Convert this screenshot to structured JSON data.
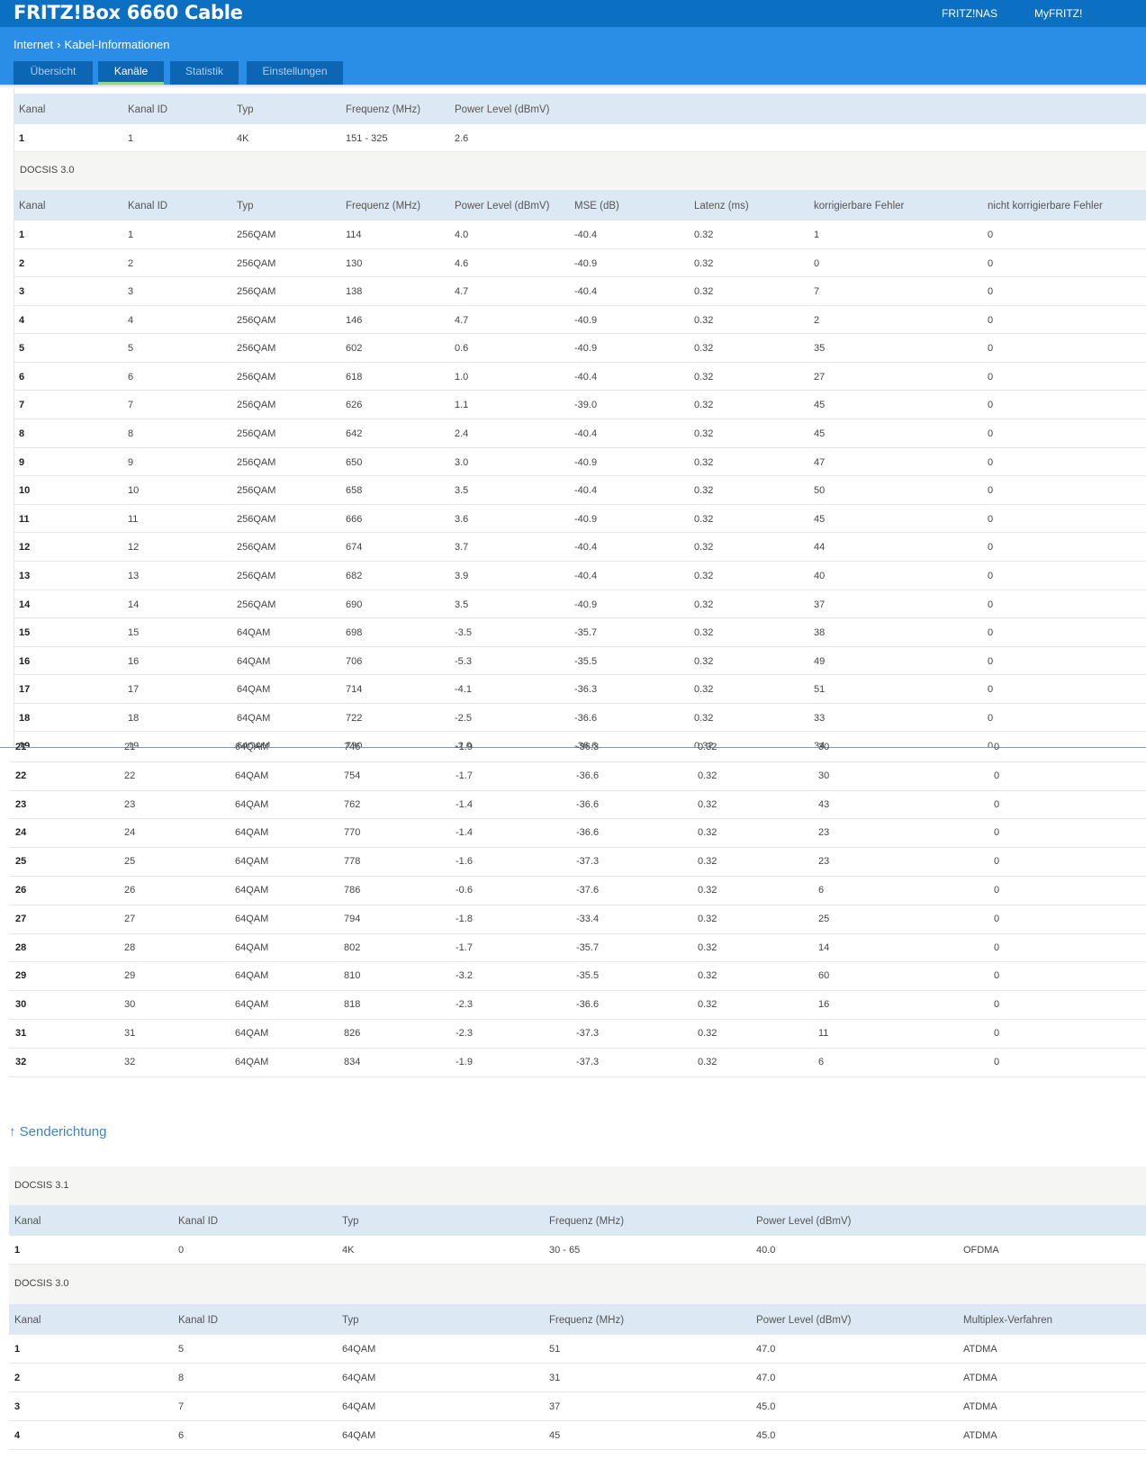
{
  "app": {
    "title": "FRITZ!Box 6660 Cable",
    "top_links": [
      "FRITZ!NAS",
      "MyFRITZ!"
    ],
    "breadcrumb": [
      "Internet",
      "Kabel-Informationen"
    ],
    "breadcrumb_sep": "›",
    "tabs": [
      "Übersicht",
      "Kanäle",
      "Statistik",
      "Einstellungen"
    ],
    "active_tab": "Kanäle"
  },
  "colors": {
    "header": "#0c70c2",
    "subheader": "#2a8ee6",
    "tab_bg": "#0d66b4",
    "tab_active_underline": "#9bd86c",
    "table_head": "#dce9f4"
  },
  "downstream": {
    "docsis31": {
      "headers": [
        "Kanal",
        "Kanal ID",
        "Typ",
        "Frequenz (MHz)",
        "Power Level (dBmV)"
      ],
      "rows": [
        [
          "1",
          "1",
          "4K",
          "151 - 325",
          "2.6"
        ]
      ]
    },
    "docsis30": {
      "label": "DOCSIS 3.0",
      "headers": [
        "Kanal",
        "Kanal ID",
        "Typ",
        "Frequenz (MHz)",
        "Power Level (dBmV)",
        "MSE (dB)",
        "Latenz (ms)",
        "korrigierbare Fehler",
        "nicht korrigierbare Fehler"
      ],
      "rows_top": [
        [
          "1",
          "1",
          "256QAM",
          "114",
          "4.0",
          "-40.4",
          "0.32",
          "1",
          "0"
        ],
        [
          "2",
          "2",
          "256QAM",
          "130",
          "4.6",
          "-40.9",
          "0.32",
          "0",
          "0"
        ],
        [
          "3",
          "3",
          "256QAM",
          "138",
          "4.7",
          "-40.4",
          "0.32",
          "7",
          "0"
        ],
        [
          "4",
          "4",
          "256QAM",
          "146",
          "4.7",
          "-40.9",
          "0.32",
          "2",
          "0"
        ],
        [
          "5",
          "5",
          "256QAM",
          "602",
          "0.6",
          "-40.9",
          "0.32",
          "35",
          "0"
        ],
        [
          "6",
          "6",
          "256QAM",
          "618",
          "1.0",
          "-40.4",
          "0.32",
          "27",
          "0"
        ],
        [
          "7",
          "7",
          "256QAM",
          "626",
          "1.1",
          "-39.0",
          "0.32",
          "45",
          "0"
        ],
        [
          "8",
          "8",
          "256QAM",
          "642",
          "2.4",
          "-40.4",
          "0.32",
          "45",
          "0"
        ],
        [
          "9",
          "9",
          "256QAM",
          "650",
          "3.0",
          "-40.9",
          "0.32",
          "47",
          "0"
        ],
        [
          "10",
          "10",
          "256QAM",
          "658",
          "3.5",
          "-40.4",
          "0.32",
          "50",
          "0"
        ],
        [
          "11",
          "11",
          "256QAM",
          "666",
          "3.6",
          "-40.9",
          "0.32",
          "45",
          "0"
        ],
        [
          "12",
          "12",
          "256QAM",
          "674",
          "3.7",
          "-40.4",
          "0.32",
          "44",
          "0"
        ],
        [
          "13",
          "13",
          "256QAM",
          "682",
          "3.9",
          "-40.4",
          "0.32",
          "40",
          "0"
        ],
        [
          "14",
          "14",
          "256QAM",
          "690",
          "3.5",
          "-40.9",
          "0.32",
          "37",
          "0"
        ],
        [
          "15",
          "15",
          "64QAM",
          "698",
          "-3.5",
          "-35.7",
          "0.32",
          "38",
          "0"
        ],
        [
          "16",
          "16",
          "64QAM",
          "706",
          "-5.3",
          "-35.5",
          "0.32",
          "49",
          "0"
        ],
        [
          "17",
          "17",
          "64QAM",
          "714",
          "-4.1",
          "-36.3",
          "0.32",
          "51",
          "0"
        ],
        [
          "18",
          "18",
          "64QAM",
          "722",
          "-2.5",
          "-36.6",
          "0.32",
          "33",
          "0"
        ],
        [
          "19",
          "19",
          "64QAM",
          "730",
          "-2.0",
          "-36.6",
          "0.32",
          "34",
          "0"
        ]
      ],
      "rows_bottom": [
        [
          "21",
          "21",
          "64QAM",
          "746",
          "-1.9",
          "-36.3",
          "0.32",
          "30",
          "0"
        ],
        [
          "22",
          "22",
          "64QAM",
          "754",
          "-1.7",
          "-36.6",
          "0.32",
          "30",
          "0"
        ],
        [
          "23",
          "23",
          "64QAM",
          "762",
          "-1.4",
          "-36.6",
          "0.32",
          "43",
          "0"
        ],
        [
          "24",
          "24",
          "64QAM",
          "770",
          "-1.4",
          "-36.6",
          "0.32",
          "23",
          "0"
        ],
        [
          "25",
          "25",
          "64QAM",
          "778",
          "-1.6",
          "-37.3",
          "0.32",
          "23",
          "0"
        ],
        [
          "26",
          "26",
          "64QAM",
          "786",
          "-0.6",
          "-37.6",
          "0.32",
          "6",
          "0"
        ],
        [
          "27",
          "27",
          "64QAM",
          "794",
          "-1.8",
          "-33.4",
          "0.32",
          "25",
          "0"
        ],
        [
          "28",
          "28",
          "64QAM",
          "802",
          "-1.7",
          "-35.7",
          "0.32",
          "14",
          "0"
        ],
        [
          "29",
          "29",
          "64QAM",
          "810",
          "-3.2",
          "-35.5",
          "0.32",
          "60",
          "0"
        ],
        [
          "30",
          "30",
          "64QAM",
          "818",
          "-2.3",
          "-36.6",
          "0.32",
          "16",
          "0"
        ],
        [
          "31",
          "31",
          "64QAM",
          "826",
          "-2.3",
          "-37.3",
          "0.32",
          "11",
          "0"
        ],
        [
          "32",
          "32",
          "64QAM",
          "834",
          "-1.9",
          "-37.3",
          "0.32",
          "6",
          "0"
        ]
      ]
    }
  },
  "upstream": {
    "title": "Senderichtung",
    "arrow": "↑",
    "docsis31": {
      "label": "DOCSIS 3.1",
      "headers": [
        "Kanal",
        "Kanal ID",
        "Typ",
        "Frequenz (MHz)",
        "Power Level (dBmV)"
      ],
      "rows": [
        [
          "1",
          "0",
          "4K",
          "30 - 65",
          "40.0",
          "OFDMA"
        ]
      ]
    },
    "docsis30": {
      "label": "DOCSIS 3.0",
      "headers": [
        "Kanal",
        "Kanal ID",
        "Typ",
        "Frequenz (MHz)",
        "Power Level (dBmV)",
        "Multiplex-Verfahren"
      ],
      "rows": [
        [
          "1",
          "5",
          "64QAM",
          "51",
          "47.0",
          "ATDMA"
        ],
        [
          "2",
          "8",
          "64QAM",
          "31",
          "47.0",
          "ATDMA"
        ],
        [
          "3",
          "7",
          "64QAM",
          "37",
          "45.0",
          "ATDMA"
        ],
        [
          "4",
          "6",
          "64QAM",
          "45",
          "45.0",
          "ATDMA"
        ]
      ]
    }
  }
}
